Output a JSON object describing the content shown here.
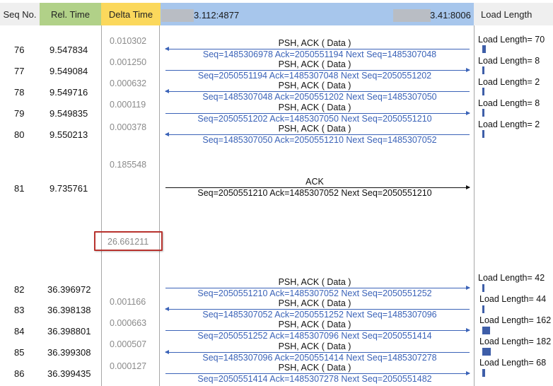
{
  "headers": {
    "seq_no": "Seq No.",
    "rel_time": "Rel. Time",
    "delta_time": "Delta Time",
    "host_a": "3.112:4877",
    "host_b": "3.41:8006",
    "load_length": "Load Length"
  },
  "colors": {
    "seq_header": "#efefef",
    "rel_header": "#b1d188",
    "delta_header": "#fbd85c",
    "host_header": "#a7c6ec",
    "load_header": "#efefef",
    "arrow_blue": "#3b63b8",
    "load_bar": "#3e5ea8",
    "highlight_border": "#b8332e"
  },
  "rows": [
    {
      "seq": "76",
      "time": "9.547834",
      "delta": "0.010302",
      "label": "PSH, ACK ( Data )",
      "seq_text": "Seq=1485306978  Ack=2050551194  Next Seq=1485307048",
      "dir": "left",
      "load": "Load Length= 70",
      "load_value": 70
    },
    {
      "seq": "77",
      "time": "9.549084",
      "delta": "0.001250",
      "label": "PSH, ACK ( Data )",
      "seq_text": "Seq=2050551194  Ack=1485307048  Next Seq=2050551202",
      "dir": "right",
      "load": "Load Length= 8",
      "load_value": 8
    },
    {
      "seq": "78",
      "time": "9.549716",
      "delta": "0.000632",
      "label": "PSH, ACK ( Data )",
      "seq_text": "Seq=1485307048  Ack=2050551202  Next Seq=1485307050",
      "dir": "left",
      "load": "Load Length= 2",
      "load_value": 2
    },
    {
      "seq": "79",
      "time": "9.549835",
      "delta": "0.000119",
      "label": "PSH, ACK ( Data )",
      "seq_text": "Seq=2050551202  Ack=1485307050  Next Seq=2050551210",
      "dir": "right",
      "load": "Load Length= 8",
      "load_value": 8
    },
    {
      "seq": "80",
      "time": "9.550213",
      "delta": "0.000378",
      "label": "PSH, ACK ( Data )",
      "seq_text": "Seq=1485307050  Ack=2050551210  Next Seq=1485307052",
      "dir": "left",
      "load": "Load Length= 2",
      "load_value": 2
    },
    {
      "seq": "81",
      "time": "9.735761",
      "delta": "0.185548",
      "label": "ACK",
      "seq_text": "Seq=2050551210  Ack=1485307052  Next Seq=2050551210",
      "dir": "right",
      "load": "",
      "load_value": 0
    },
    {
      "seq": "82",
      "time": "36.396972",
      "delta": "26.661211",
      "label": "PSH, ACK ( Data )",
      "seq_text": "Seq=2050551210  Ack=1485307052  Next Seq=2050551252",
      "dir": "right",
      "load": "Load Length= 42",
      "load_value": 42
    },
    {
      "seq": "83",
      "time": "36.398138",
      "delta": "0.001166",
      "label": "PSH, ACK ( Data )",
      "seq_text": "Seq=1485307052  Ack=2050551252  Next Seq=1485307096",
      "dir": "left",
      "load": "Load Length= 44",
      "load_value": 44
    },
    {
      "seq": "84",
      "time": "36.398801",
      "delta": "0.000663",
      "label": "PSH, ACK ( Data )",
      "seq_text": "Seq=2050551252  Ack=1485307096  Next Seq=2050551414",
      "dir": "right",
      "load": "Load Length= 162",
      "load_value": 162
    },
    {
      "seq": "85",
      "time": "36.399308",
      "delta": "0.000507",
      "label": "PSH, ACK ( Data )",
      "seq_text": "Seq=1485307096  Ack=2050551414  Next Seq=1485307278",
      "dir": "left",
      "load": "Load Length= 182",
      "load_value": 182
    },
    {
      "seq": "86",
      "time": "36.399435",
      "delta": "0.000127",
      "label": "PSH, ACK ( Data )",
      "seq_text": "Seq=2050551414  Ack=1485307278  Next Seq=2050551482",
      "dir": "right",
      "load": "Load Length= 68",
      "load_value": 68
    }
  ]
}
